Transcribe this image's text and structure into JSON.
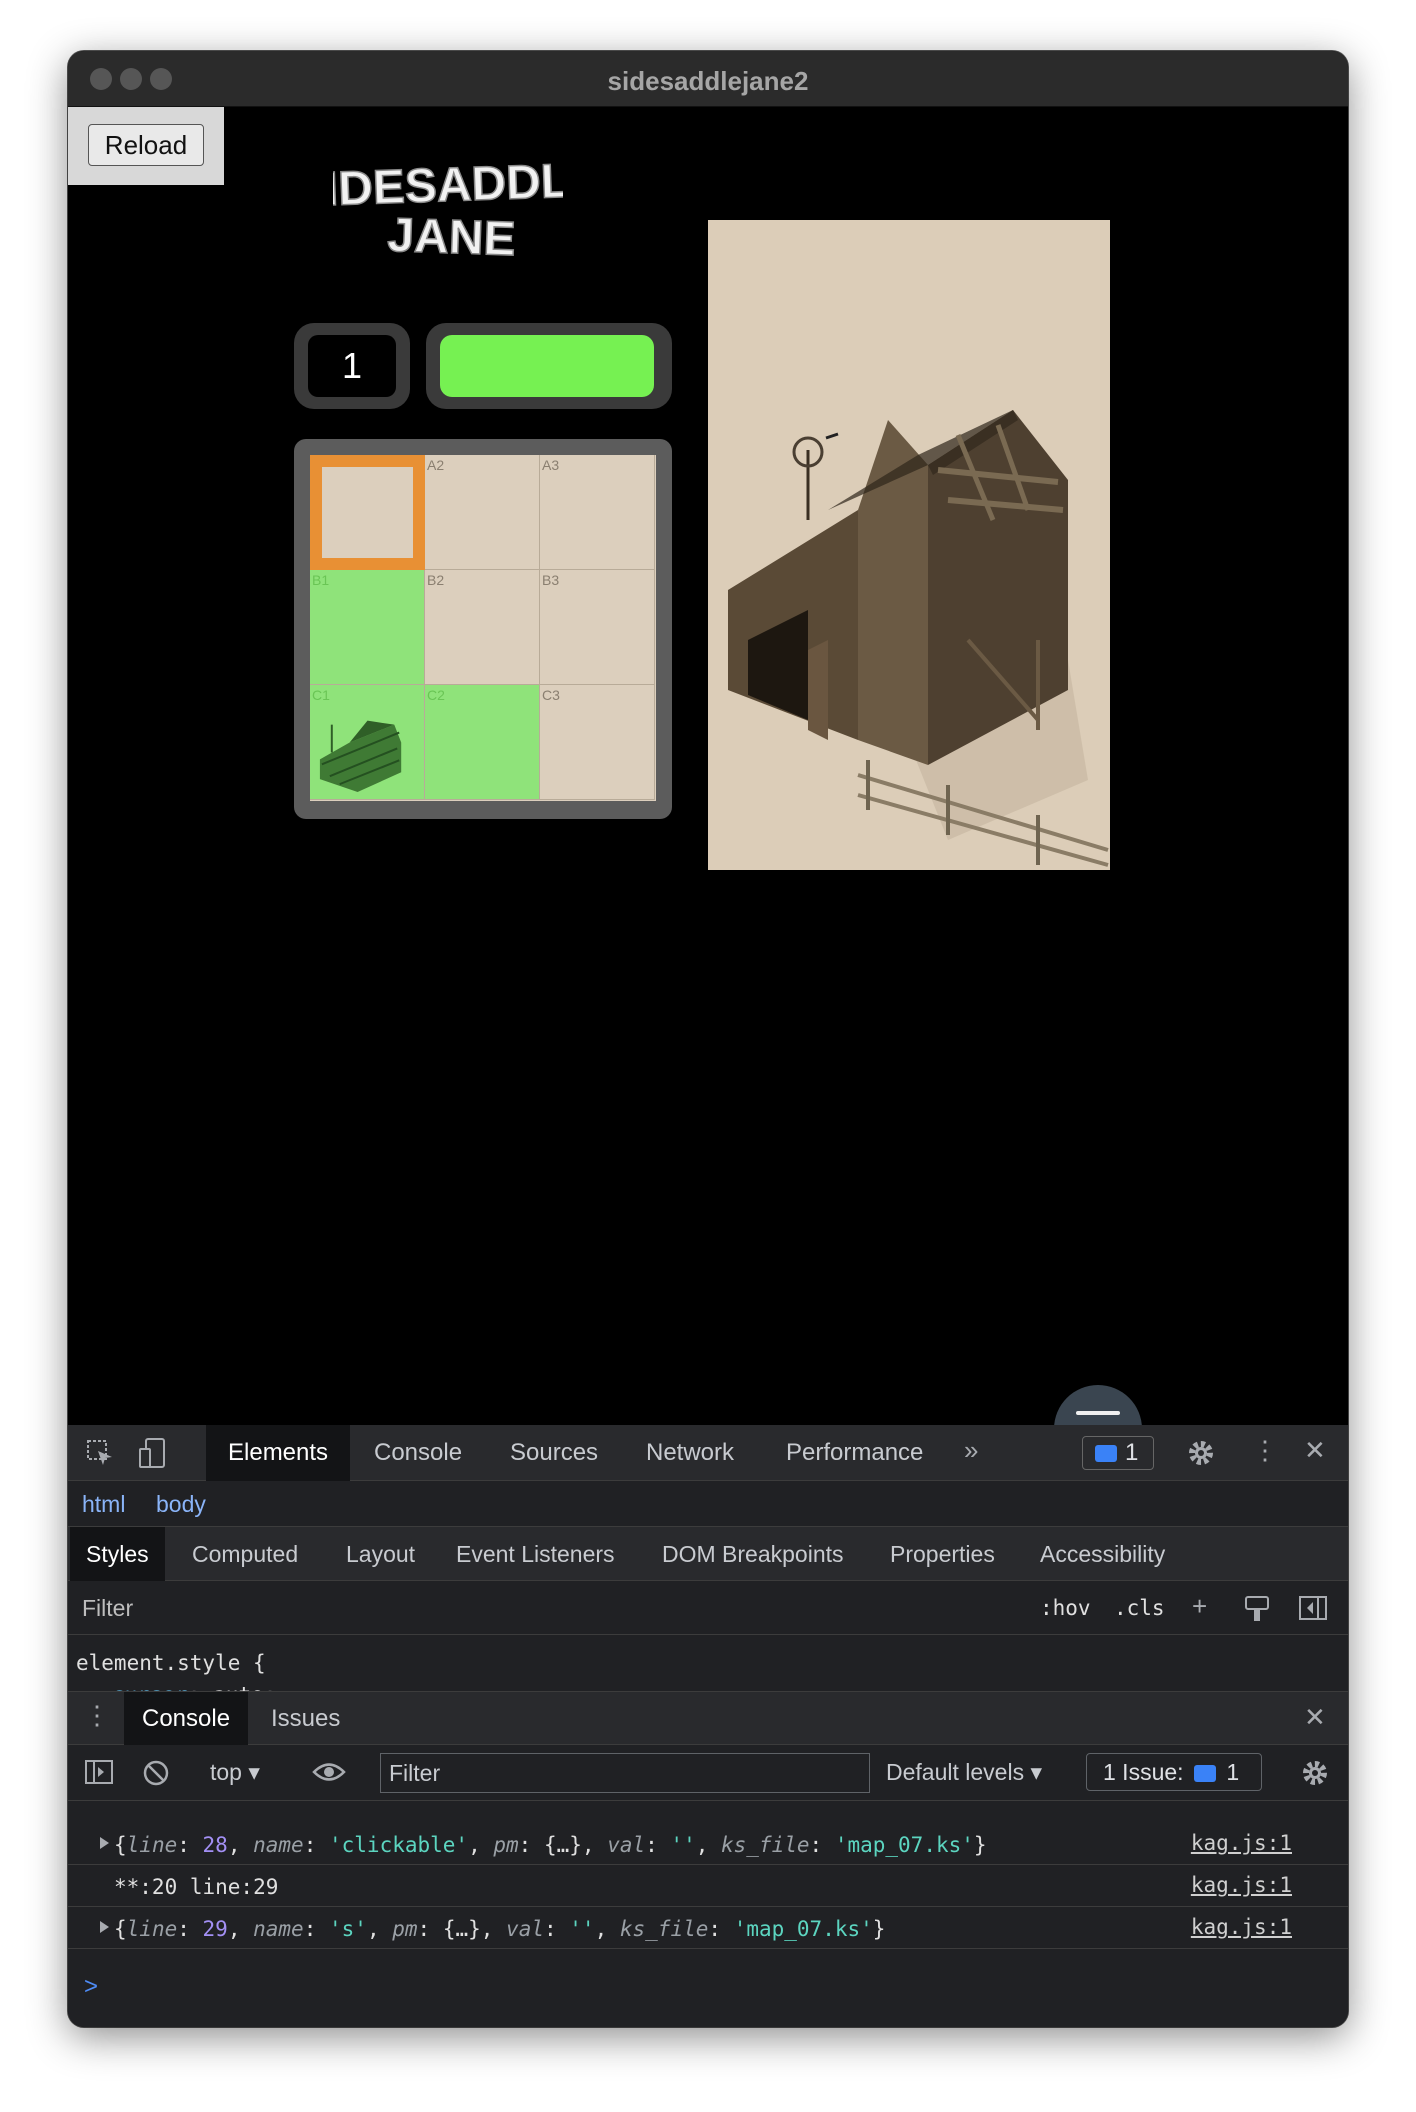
{
  "window": {
    "title": "sidesaddlejane2"
  },
  "game": {
    "reload_label": "Reload",
    "logo_text_line1": "SIDESADDLE",
    "logo_text_line2": "JANE",
    "counter": "1",
    "status_color": "#76f152",
    "map_cells": [
      {
        "label": "",
        "state": "current"
      },
      {
        "label": "A2",
        "state": "plain"
      },
      {
        "label": "A3",
        "state": "plain"
      },
      {
        "label": "B1",
        "state": "green"
      },
      {
        "label": "B2",
        "state": "plain"
      },
      {
        "label": "B3",
        "state": "plain"
      },
      {
        "label": "C1",
        "state": "green-barn"
      },
      {
        "label": "C2",
        "state": "green"
      },
      {
        "label": "C3",
        "state": "plain"
      }
    ],
    "accent_orange": "#e89034"
  },
  "devtools": {
    "tabs": [
      "Elements",
      "Console",
      "Sources",
      "Network",
      "Performance"
    ],
    "more_icon": "chevron-double-right-icon",
    "issues_count": "1",
    "breadcrumbs": [
      "html",
      "body"
    ],
    "subtabs": [
      "Styles",
      "Computed",
      "Layout",
      "Event Listeners",
      "DOM Breakpoints",
      "Properties",
      "Accessibility"
    ],
    "filter_placeholder": "Filter",
    "hov_label": ":hov",
    "cls_label": ".cls",
    "element_style": {
      "selector": "element.style {",
      "prop": "cursor",
      "value": " auto;"
    },
    "drawer_tabs": [
      "Console",
      "Issues"
    ],
    "context": "top",
    "console_filter_placeholder": "Filter",
    "levels": "Default levels",
    "issues_label": "1 Issue:",
    "issues_label_count": "1",
    "logs": {
      "row1": {
        "line": "28",
        "name": "'clickable'",
        "val": "''",
        "ks_file": "'map_07.ks'",
        "src": "kag.js:1"
      },
      "row2": {
        "text": "**:20  line:29",
        "src": "kag.js:1"
      },
      "row3": {
        "line": "29",
        "name": "'s'",
        "val": "''",
        "ks_file": "'map_07.ks'",
        "src": "kag.js:1"
      }
    },
    "prompt": ">"
  }
}
